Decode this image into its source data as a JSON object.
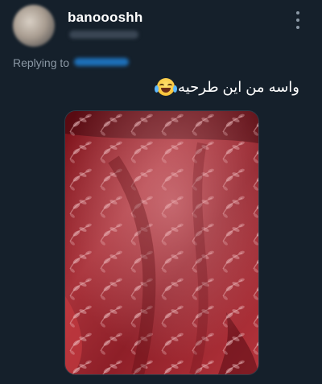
{
  "tweet": {
    "display_name": "banoooshh",
    "replying_label": "Replying to",
    "text": "واسه من این طرحیه",
    "emoji": "face-with-tears-of-joy"
  },
  "colors": {
    "background": "#15202b",
    "text_primary": "#ffffff",
    "text_secondary": "#8b98a5",
    "accent": "#1d9bf0"
  },
  "photo": {
    "subject": "red velvet fabric with floral leaf pattern"
  }
}
